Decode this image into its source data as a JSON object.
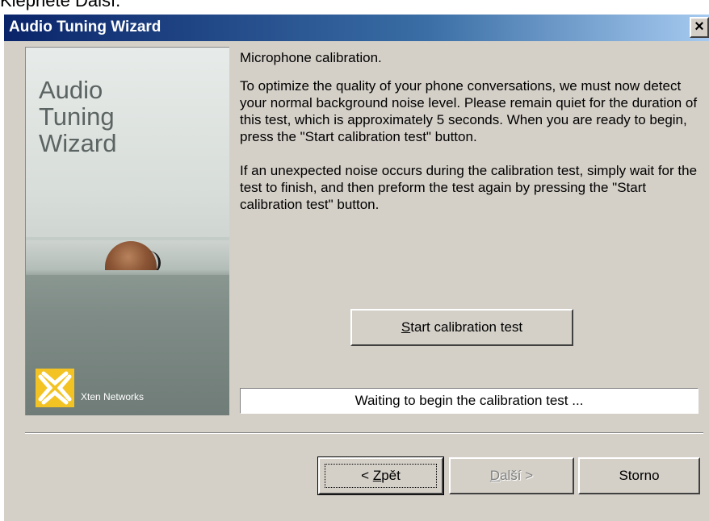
{
  "background_text": "Klepněte Další.",
  "window": {
    "title": "Audio Tuning Wizard",
    "close_symbol": "×"
  },
  "side_panel": {
    "title_line1": "Audio",
    "title_line2": "Tuning",
    "title_line3": "Wizard",
    "logo_icon": "xten-logo-icon",
    "logo_text": "Xten Networks"
  },
  "content": {
    "heading": "Microphone calibration.",
    "paragraph1": "To optimize the quality of your phone conversations, we must now detect your normal background noise level. Please remain quiet for the duration of this test, which is approximately 5 seconds.  When you are ready to begin, press the \"Start calibration test\" button.",
    "paragraph2": "If an unexpected noise occurs during the calibration test, simply wait for the test to finish, and then preform the test again by pressing the \"Start calibration test\" button."
  },
  "start_button": {
    "mnemonic": "S",
    "rest": "tart calibration test"
  },
  "status": "Waiting to begin the calibration test ...",
  "buttons": {
    "back_prefix": "< ",
    "back_mnemonic": "Z",
    "back_rest": "pět",
    "next_mnemonic": "D",
    "next_rest": "alší >",
    "cancel": "Storno"
  },
  "colors": {
    "titlebar_start": "#0a246a",
    "titlebar_end": "#a6caf0",
    "dialog_bg": "#d4d0c8",
    "logo_yellow": "#f2c323"
  }
}
